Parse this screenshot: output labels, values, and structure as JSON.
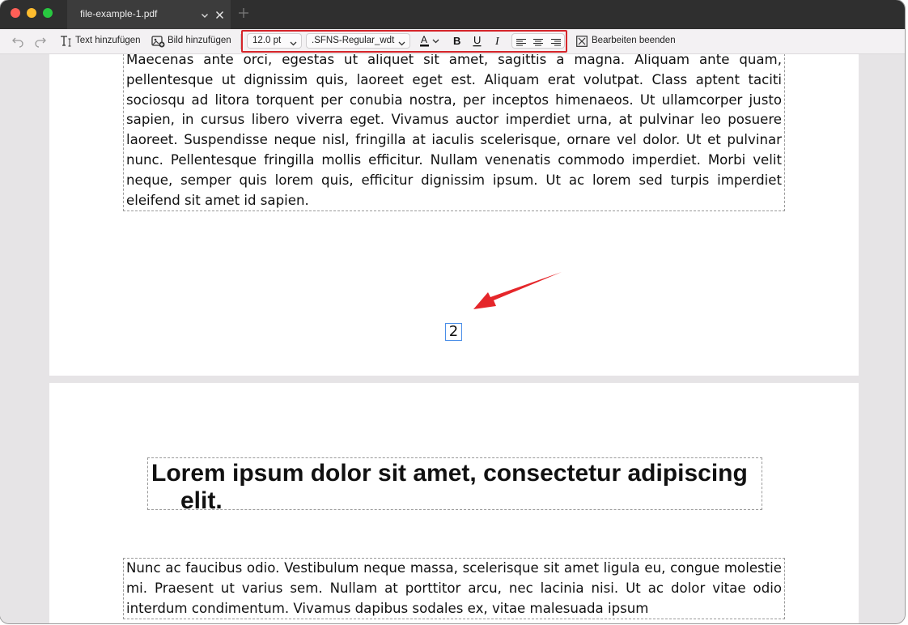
{
  "window": {
    "tab_title": "file-example-1.pdf"
  },
  "toolbar": {
    "undo_icon": "undo-icon",
    "redo_icon": "redo-icon",
    "add_text_label": "Text hinzufügen",
    "add_image_label": "Bild hinzufügen",
    "font_size_value": "12.0 pt",
    "font_name_value": ".SFNS-Regular_wdt",
    "text_color_icon": "text-color-icon",
    "bold_icon": "bold-icon",
    "underline_icon": "underline-icon",
    "italic_icon": "italic-icon",
    "align_left_icon": "align-left-icon",
    "align_center_icon": "align-center-icon",
    "align_right_icon": "align-right-icon",
    "end_editing_label": "Bearbeiten beenden"
  },
  "document": {
    "page1": {
      "paragraph": "Maecenas ante orci, egestas ut aliquet sit amet, sagittis a magna. Aliquam ante quam, pellentesque ut dignissim quis, laoreet eget est. Aliquam erat volutpat. Class aptent taciti sociosqu ad litora torquent per conubia nostra, per inceptos himenaeos. Ut ullamcorper justo sapien, in cursus libero viverra eget. Vivamus auctor imperdiet urna, at pulvinar leo posuere laoreet. Suspendisse neque nisl, fringilla at iaculis scelerisque, ornare vel dolor. Ut et pulvinar nunc. Pellentesque fringilla mollis efficitur. Nullam venenatis commodo imperdiet. Morbi velit neque, semper quis lorem quis, efficitur dignissim ipsum. Ut ac lorem sed turpis imperdiet eleifend sit amet id sapien.",
      "page_number": "2"
    },
    "page2": {
      "heading_line1": "Lorem ipsum dolor sit amet, consectetur adipiscing",
      "heading_line2": "elit.",
      "paragraph": "Nunc ac faucibus odio. Vestibulum neque massa, scelerisque sit amet ligula eu, congue molestie mi. Praesent ut varius sem. Nullam at porttitor arcu, nec lacinia nisi. Ut ac dolor vitae odio interdum condimentum. Vivamus dapibus sodales ex, vitae malesuada ipsum"
    }
  },
  "colors": {
    "annotation_red": "#d5252a",
    "selection_blue": "#4a8ee8"
  }
}
